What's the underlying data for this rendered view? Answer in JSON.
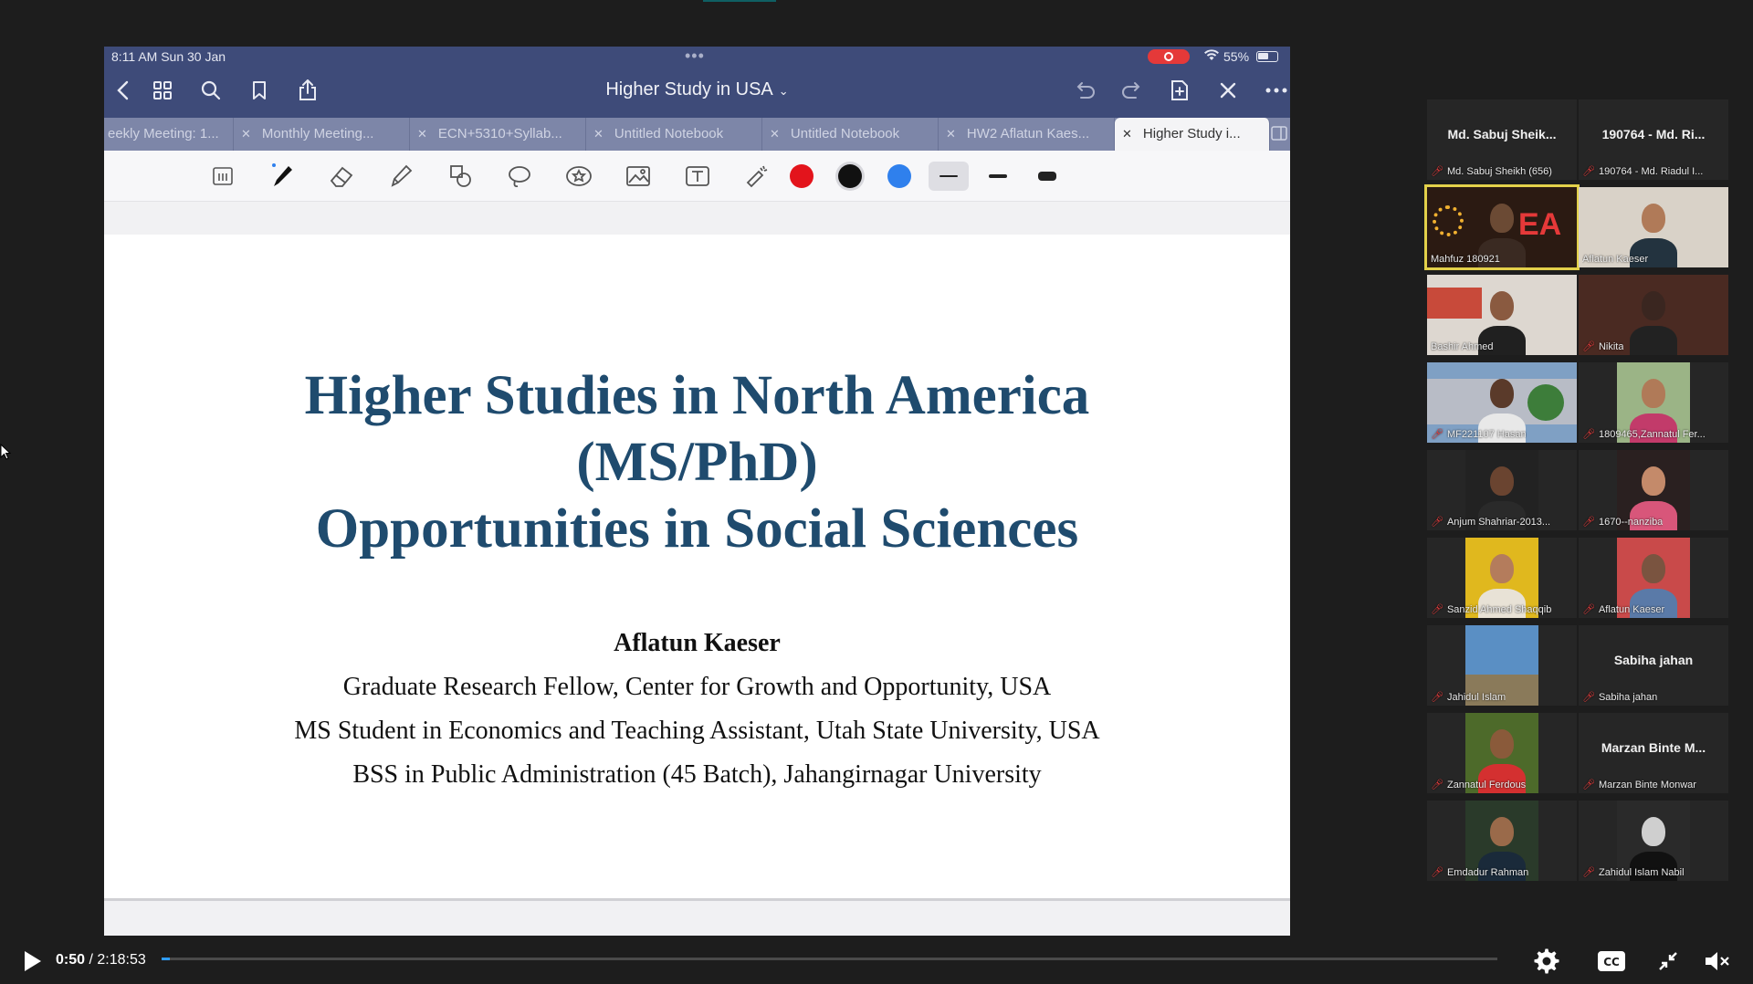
{
  "ipad_status": {
    "time": "8:11 AM  Sun 30 Jan",
    "battery": "55%"
  },
  "notebook": {
    "title": "Higher Study in USA"
  },
  "tabs": [
    {
      "label": "eekly Meeting: 1...",
      "closable": false
    },
    {
      "label": "Monthly Meeting...",
      "closable": true
    },
    {
      "label": "ECN+5310+Syllab...",
      "closable": true
    },
    {
      "label": "Untitled Notebook",
      "closable": true
    },
    {
      "label": "Untitled Notebook",
      "closable": true
    },
    {
      "label": "HW2 Aflatun Kaes...",
      "closable": true
    },
    {
      "label": "Higher Study i...",
      "closable": true,
      "active": true
    }
  ],
  "colors": {
    "red": "#e3141c",
    "black": "#111111",
    "blue": "#2f80ed",
    "nav": "#3e4b79",
    "headline": "#1f4b6e"
  },
  "slide": {
    "title_line1": "Higher Studies in North America",
    "title_line2": "(MS/PhD)",
    "title_line3": "Opportunities in Social Sciences",
    "author": "Aflatun Kaeser",
    "affiliation1": "Graduate Research Fellow, Center for Growth and Opportunity, USA",
    "affiliation2": "MS Student in Economics and Teaching Assistant, Utah State University, USA",
    "affiliation3": "BSS in Public Administration (45 Batch), Jahangirnagar University"
  },
  "participants": [
    {
      "big": "Md. Sabuj Sheik...",
      "label": "Md. Sabuj Sheikh (656)",
      "muted": true
    },
    {
      "big": "190764 - Md. Ri...",
      "label": "190764 - Md. Riadul I...",
      "muted": true
    },
    {
      "label": "Mahfuz 180921",
      "muted": false,
      "speaking": true,
      "video": "dea"
    },
    {
      "label": "Aflatun Kaeser",
      "muted": false,
      "video": "room"
    },
    {
      "label": "Bashir Ahmed",
      "muted": false,
      "video": "office"
    },
    {
      "label": "Nikita",
      "muted": true,
      "video": "dark"
    },
    {
      "label": "MF221107 Hasan",
      "muted": true,
      "video": "building"
    },
    {
      "label": "1809465,Zannatul Fer...",
      "muted": true,
      "video": "mask"
    },
    {
      "label": "Anjum Shahriar-2013...",
      "muted": true,
      "video": "portrait"
    },
    {
      "label": "1670--nanziba",
      "muted": true,
      "video": "glasses"
    },
    {
      "label": "Sanzid Ahmed Shaqqib",
      "muted": true,
      "video": "yellow"
    },
    {
      "label": "Aflatun Kaeser",
      "muted": true,
      "video": "poster"
    },
    {
      "label": "Jahidul Islam",
      "muted": true,
      "video": "sky"
    },
    {
      "big": "Sabiha jahan",
      "label": "Sabiha jahan",
      "muted": true
    },
    {
      "label": "Zannatul Ferdous",
      "muted": true,
      "video": "tree"
    },
    {
      "big": "Marzan Binte M...",
      "label": "Marzan Binte Monwar",
      "muted": true
    },
    {
      "label": "Emdadur Rahman",
      "muted": true,
      "video": "young"
    },
    {
      "label": "Zahidul Islam Nabil",
      "muted": true,
      "video": "bw"
    }
  ],
  "player": {
    "current": "0:50",
    "separator": " / ",
    "duration": "2:18:53",
    "progress": 0.006
  }
}
